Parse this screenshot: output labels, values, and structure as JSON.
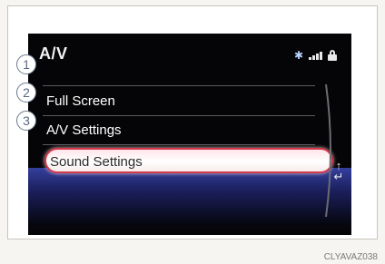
{
  "screen": {
    "title": "A/V",
    "status_icons": [
      "bluetooth-icon",
      "signal-bars-icon",
      "lock-icon"
    ],
    "menu": [
      {
        "number": "1",
        "label": "Full Screen"
      },
      {
        "number": "2",
        "label": "A/V Settings"
      },
      {
        "number": "3",
        "label": "Sound Settings",
        "selected": true
      }
    ],
    "side_button_icon": "back-arrow-icon"
  },
  "caption": "CLYAVAZ038",
  "colors": {
    "selection_border": "#d23a4b",
    "selection_fill": "#ffffff",
    "callout_border": "#6d7a8c",
    "screen_bg": "#050507",
    "glow": "#3d49b7"
  }
}
